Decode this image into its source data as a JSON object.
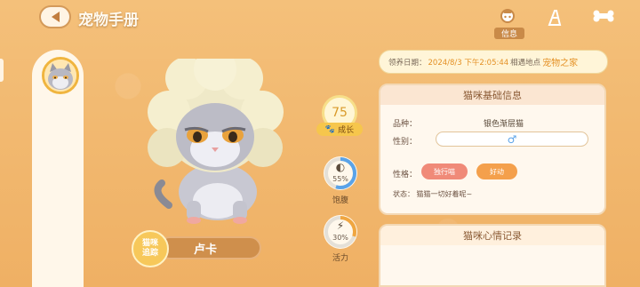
{
  "header": {
    "title": "宠物手册"
  },
  "tabs": {
    "active_label": "信息"
  },
  "pet": {
    "name": "卢卡",
    "track_label": "猫咪追踪"
  },
  "stats": {
    "growth_value": "75",
    "growth_label": "成长",
    "satiety": {
      "value": "55%",
      "label": "饱腹",
      "fill": 0.55
    },
    "vitality": {
      "value": "30%",
      "label": "活力",
      "fill": 0.3
    }
  },
  "adoption": {
    "date_label": "领养日期：",
    "date_value": "2024/8/3 下午2:05:44",
    "place_label": "相遇地点",
    "place_value": "宠物之家"
  },
  "basic_info": {
    "title": "猫咪基础信息",
    "breed_label": "品种：",
    "breed_value": "银色渐层猫",
    "gender_label": "性别：",
    "gender_value": "♂",
    "traits_label": "性格：",
    "traits": [
      "独行喵",
      "好动"
    ],
    "status_label": "状态：",
    "status_value": "猫猫一切好着呢~"
  },
  "mood_card": {
    "title": "猫咪心情记录"
  },
  "colors": {
    "accent": "#f2b86e",
    "trait1": "#f08a78",
    "trait2": "#f4a04c",
    "gender": "#5aa3e8"
  }
}
